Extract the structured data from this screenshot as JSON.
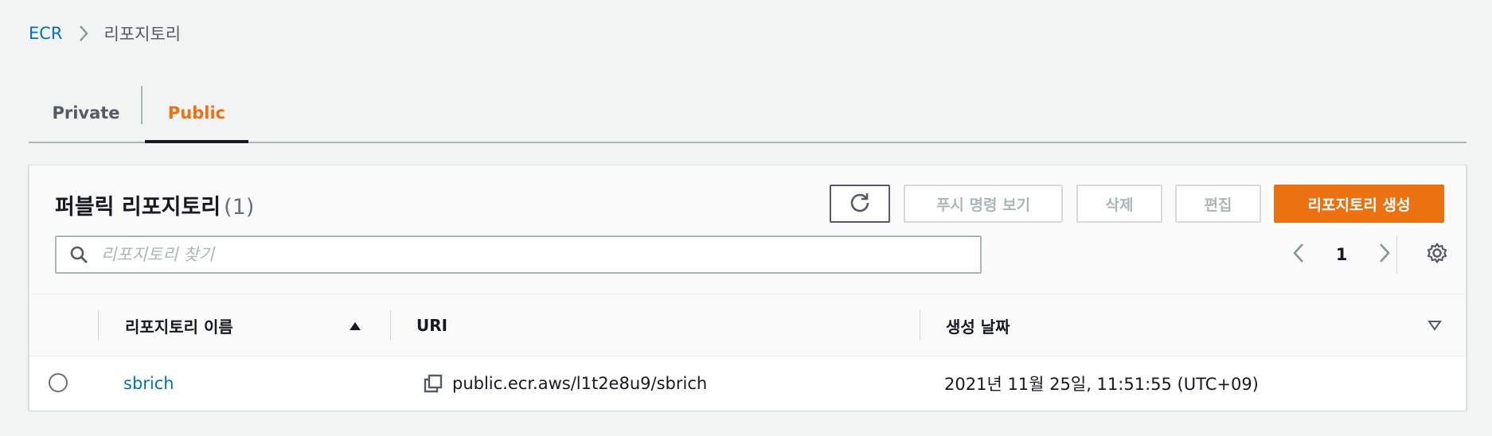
{
  "breadcrumb": {
    "root": "ECR",
    "current": "리포지토리"
  },
  "tabs": [
    {
      "label": "Private",
      "selected": false
    },
    {
      "label": "Public",
      "selected": true
    }
  ],
  "panel": {
    "title": "퍼블릭 리포지토리",
    "count": "(1)",
    "buttons": {
      "refresh_icon": "refresh-icon",
      "push": "푸시 명령 보기",
      "delete": "삭제",
      "edit": "편집",
      "create": "리포지토리 생성"
    },
    "search": {
      "placeholder": "리포지토리 찾기",
      "value": ""
    },
    "pagination": {
      "current_page": "1"
    }
  },
  "table": {
    "columns": {
      "name": "리포지토리 이름",
      "uri": "URI",
      "created": "생성 날짜"
    },
    "rows": [
      {
        "name": "sbrich",
        "uri": "public.ecr.aws/l1t2e8u9/sbrich",
        "created": "2021년 11월 25일, 11:51:55 (UTC+09)"
      }
    ]
  },
  "colors": {
    "accent": "#ec7211",
    "link": "#0073bb",
    "background": "#f2f3f3"
  }
}
